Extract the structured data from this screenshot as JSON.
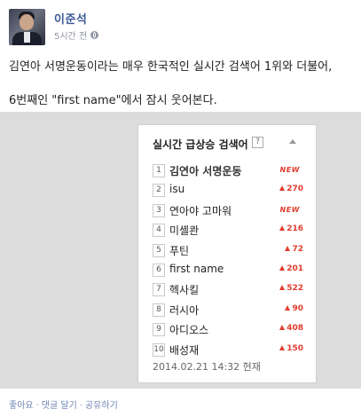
{
  "post": {
    "author": "이준석",
    "time": "5시간 전",
    "privacy_icon": "globe-icon",
    "line1": "김연아 서명운동이라는 매우 한국적인 실시간 검색어 1위와 더불어,",
    "line2": "6번째인 \"first name\"에서 잠시 웃어본다."
  },
  "panel": {
    "title": "실시간 급상승 검색어",
    "help": "?",
    "timestamp": "2014.02.21 14:32 현재",
    "rows": [
      {
        "rank": "1",
        "term": "김연아 서명운동",
        "change": "NEW"
      },
      {
        "rank": "2",
        "term": "isu",
        "change": "270"
      },
      {
        "rank": "3",
        "term": "연아야 고마워",
        "change": "NEW"
      },
      {
        "rank": "4",
        "term": "미셸콴",
        "change": "216"
      },
      {
        "rank": "5",
        "term": "푸틴",
        "change": "72"
      },
      {
        "rank": "6",
        "term": "first name",
        "change": "201"
      },
      {
        "rank": "7",
        "term": "헥사킬",
        "change": "522"
      },
      {
        "rank": "8",
        "term": "러시아",
        "change": "90"
      },
      {
        "rank": "9",
        "term": "아디오스",
        "change": "408"
      },
      {
        "rank": "10",
        "term": "배성재",
        "change": "150"
      }
    ]
  },
  "actions": {
    "like": "좋아요",
    "comment": "댓글 달기",
    "share": "공유하기",
    "separator": "·"
  },
  "colors": {
    "link": "#3b5998",
    "rise": "#e23b2e"
  }
}
